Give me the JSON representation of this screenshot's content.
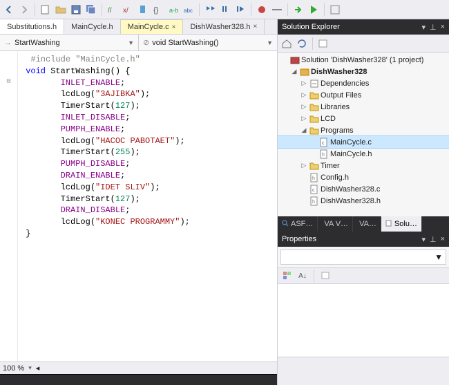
{
  "toolbar": {
    "icons": [
      "back",
      "forward",
      "new",
      "open",
      "save",
      "save-all",
      "comment",
      "uncomment",
      "bookmark",
      "find",
      "replace",
      "t1",
      "t2",
      "step-into",
      "step-over",
      "step-out",
      "stop",
      "restart",
      "play"
    ]
  },
  "tabs": [
    {
      "label": "Substitutions.h",
      "active": false
    },
    {
      "label": "MainCycle.h",
      "active": false
    },
    {
      "label": "MainCycle.c",
      "active": true,
      "closable": true
    },
    {
      "label": "DishWasher328.h",
      "active": false,
      "closable": true
    }
  ],
  "dropdowns": {
    "scope_prefix": "→",
    "scope": "StartWashing",
    "member_prefix": "⊘",
    "member": "void StartWashing()"
  },
  "code": [
    {
      "t": "pre",
      "s": "#include \"MainCycle.h\""
    },
    {
      "t": "blank",
      "s": ""
    },
    {
      "t": "sig",
      "kw": "void",
      "fn": " StartWashing",
      "rest": "() {"
    },
    {
      "t": "macro",
      "s": "INLET_ENABLE",
      "tail": ";"
    },
    {
      "t": "call",
      "fn": "lcdLog",
      "args": "\"3AJIBKA\""
    },
    {
      "t": "call",
      "fn": "TimerStart",
      "args": "127",
      "num": true
    },
    {
      "t": "macro",
      "s": "INLET_DISABLE",
      "tail": ";"
    },
    {
      "t": "macro",
      "s": "PUMPH_ENABLE",
      "tail": ";"
    },
    {
      "t": "call",
      "fn": "lcdLog",
      "args": "\"HACOC PABOTAET\""
    },
    {
      "t": "call",
      "fn": "TimerStart",
      "args": "255",
      "num": true
    },
    {
      "t": "macro",
      "s": "PUMPH_DISABLE",
      "tail": ";"
    },
    {
      "t": "macro",
      "s": "DRAIN_ENABLE",
      "tail": ";"
    },
    {
      "t": "call",
      "fn": "lcdLog",
      "args": "\"IDET SLIV\""
    },
    {
      "t": "call",
      "fn": "TimerStart",
      "args": "127",
      "num": true
    },
    {
      "t": "macro",
      "s": "DRAIN_DISABLE",
      "tail": ";"
    },
    {
      "t": "call",
      "fn": "lcdLog",
      "args": "\"KONEC PROGRAMMY\""
    },
    {
      "t": "close",
      "s": "}"
    }
  ],
  "zoom": "100 %",
  "solution_explorer": {
    "title": "Solution Explorer",
    "root": "Solution 'DishWasher328' (1 project)",
    "project": "DishWasher328",
    "nodes": [
      {
        "depth": 2,
        "twist": "▷",
        "icon": "ref",
        "label": "Dependencies"
      },
      {
        "depth": 2,
        "twist": "▷",
        "icon": "fld",
        "label": "Output Files"
      },
      {
        "depth": 2,
        "twist": "▷",
        "icon": "fld",
        "label": "Libraries"
      },
      {
        "depth": 2,
        "twist": "▷",
        "icon": "fld",
        "label": "LCD"
      },
      {
        "depth": 2,
        "twist": "◢",
        "icon": "fld",
        "label": "Programs"
      },
      {
        "depth": 3,
        "twist": "",
        "icon": "c",
        "label": "MainCycle.c",
        "selected": true
      },
      {
        "depth": 3,
        "twist": "",
        "icon": "h",
        "label": "MainCycle.h"
      },
      {
        "depth": 2,
        "twist": "▷",
        "icon": "fld",
        "label": "Timer"
      },
      {
        "depth": 2,
        "twist": "",
        "icon": "h",
        "label": "Config.h"
      },
      {
        "depth": 2,
        "twist": "",
        "icon": "c",
        "label": "DishWasher328.c"
      },
      {
        "depth": 2,
        "twist": "",
        "icon": "h",
        "label": "DishWasher328.h"
      }
    ]
  },
  "tool_tabs": [
    {
      "label": "ASF…",
      "icon": "mag"
    },
    {
      "label": "VA V…",
      "icon": "dot-red"
    },
    {
      "label": "VA…",
      "icon": "dot-org"
    },
    {
      "label": "Solu…",
      "icon": "doc",
      "active": true
    }
  ],
  "properties": {
    "title": "Properties"
  }
}
